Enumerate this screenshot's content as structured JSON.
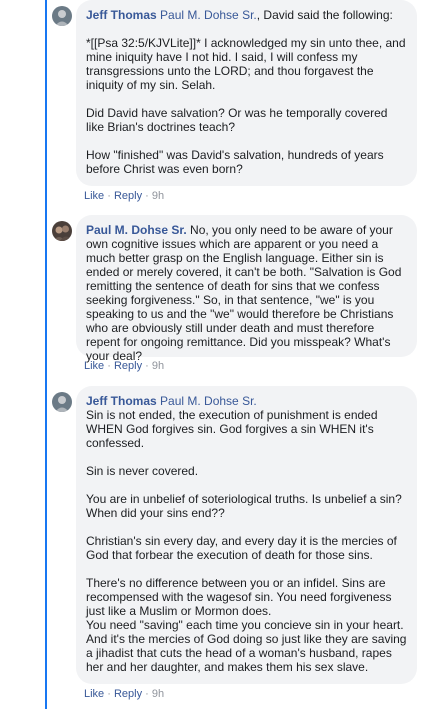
{
  "comments": [
    {
      "author": "Jeff Thomas",
      "mention": "Paul M. Dohse Sr.",
      "after_mention": ", David said the following:",
      "paragraphs": [
        "*[[Psa 32:5/KJVLite]]* I acknowledged my sin unto thee, and mine iniquity have I not hid. I said, I will confess my transgressions unto the LORD; and thou forgavest the iniquity of my sin. Selah.",
        "Did David have salvation? Or was he temporally covered like Brian's doctrines teach?",
        "How \"finished\" was David's salvation, hundreds of years before Christ was even born?"
      ],
      "like": "Like",
      "reply": "Reply",
      "time": "9h"
    },
    {
      "author": "Paul M. Dohse Sr.",
      "text": "No, you only need to be aware of your own cognitive issues which are apparent or you need a much better grasp on the English language. Either sin is ended or merely covered, it can't be both. \"Salvation is God remitting the sentence of death for sins that we confess seeking forgiveness.\" So, in that sentence, \"we\" is you speaking to us and the \"we\" would therefore be Christians who are obviously still under death and must therefore repent for ongoing remittance. Did you misspeak? What's your deal?",
      "like": "Like",
      "reply": "Reply",
      "time": "9h"
    },
    {
      "author": "Jeff Thomas",
      "mention": "Paul M. Dohse Sr.",
      "paragraphs": [
        "Sin is not ended, the execution of punishment is ended WHEN God forgives sin. God forgives a sin WHEN it's confessed.",
        "Sin is never covered.",
        "You are in unbelief of soteriological truths. Is unbelief a sin? When did your sins end??",
        "Christian's sin every day, and every day it is the mercies of God that forbear the execution of death for those sins.",
        "There's no difference between you or an infidel. Sins are recompensed with the wagesof sin. You need forgiveness just like a Muslim or Mormon does.",
        "You need \"saving\" each time you concieve sin in your heart. And it's the mercies of God doing so just like they are saving a jihadist that cuts the head of a woman's husband, rapes her and her daughter, and makes them his sex slave."
      ],
      "like": "Like",
      "reply": "Reply",
      "time": "9h"
    }
  ]
}
